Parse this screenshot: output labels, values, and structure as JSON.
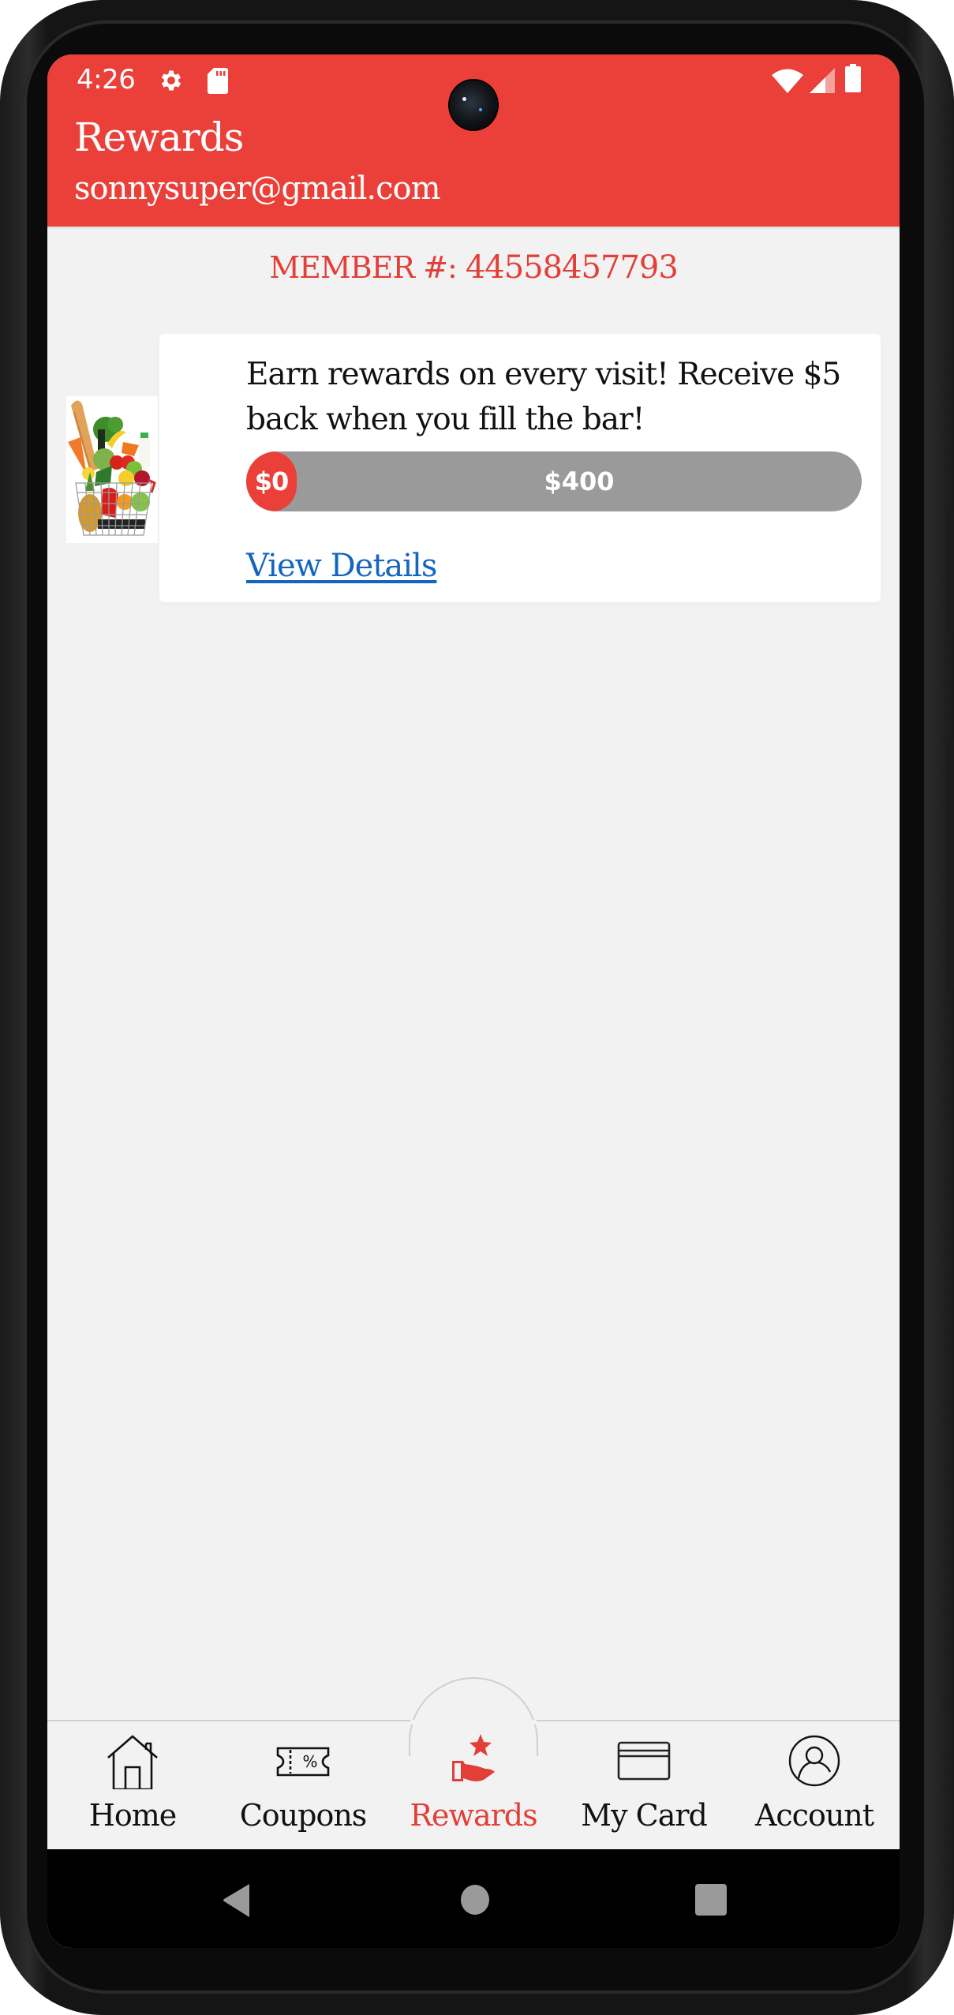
{
  "status_bar": {
    "time": "4:26",
    "left_icons": [
      "gear-icon",
      "sd-card-icon"
    ],
    "right_icons": [
      "wifi-icon",
      "signal-icon",
      "battery-icon"
    ]
  },
  "header": {
    "title": "Rewards",
    "email": "sonnysuper@gmail.com"
  },
  "member": {
    "label": "MEMBER #:",
    "number": "44558457793"
  },
  "reward_card": {
    "image": "grocery-basket-image",
    "description": "Earn rewards on every visit! Receive $5 back when you fill the bar!",
    "progress": {
      "current_label": "$0",
      "goal_label": "$400",
      "current_value": 0,
      "goal_value": 400,
      "percent": 0
    },
    "link_label": "View Details"
  },
  "bottom_nav": {
    "items": [
      {
        "label": "Home",
        "icon": "home-icon",
        "active": false
      },
      {
        "label": "Coupons",
        "icon": "coupon-icon",
        "active": false
      },
      {
        "label": "Rewards",
        "icon": "reward-hand-star-icon",
        "active": true
      },
      {
        "label": "My Card",
        "icon": "card-icon",
        "active": false
      },
      {
        "label": "Account",
        "icon": "account-icon",
        "active": false
      }
    ]
  },
  "system_nav": {
    "buttons": [
      "back",
      "home",
      "recents"
    ]
  },
  "colors": {
    "brand_red": "#ea4039",
    "link_blue": "#1565c0",
    "progress_track": "#9a9a9a",
    "background": "#f2f2f2"
  }
}
